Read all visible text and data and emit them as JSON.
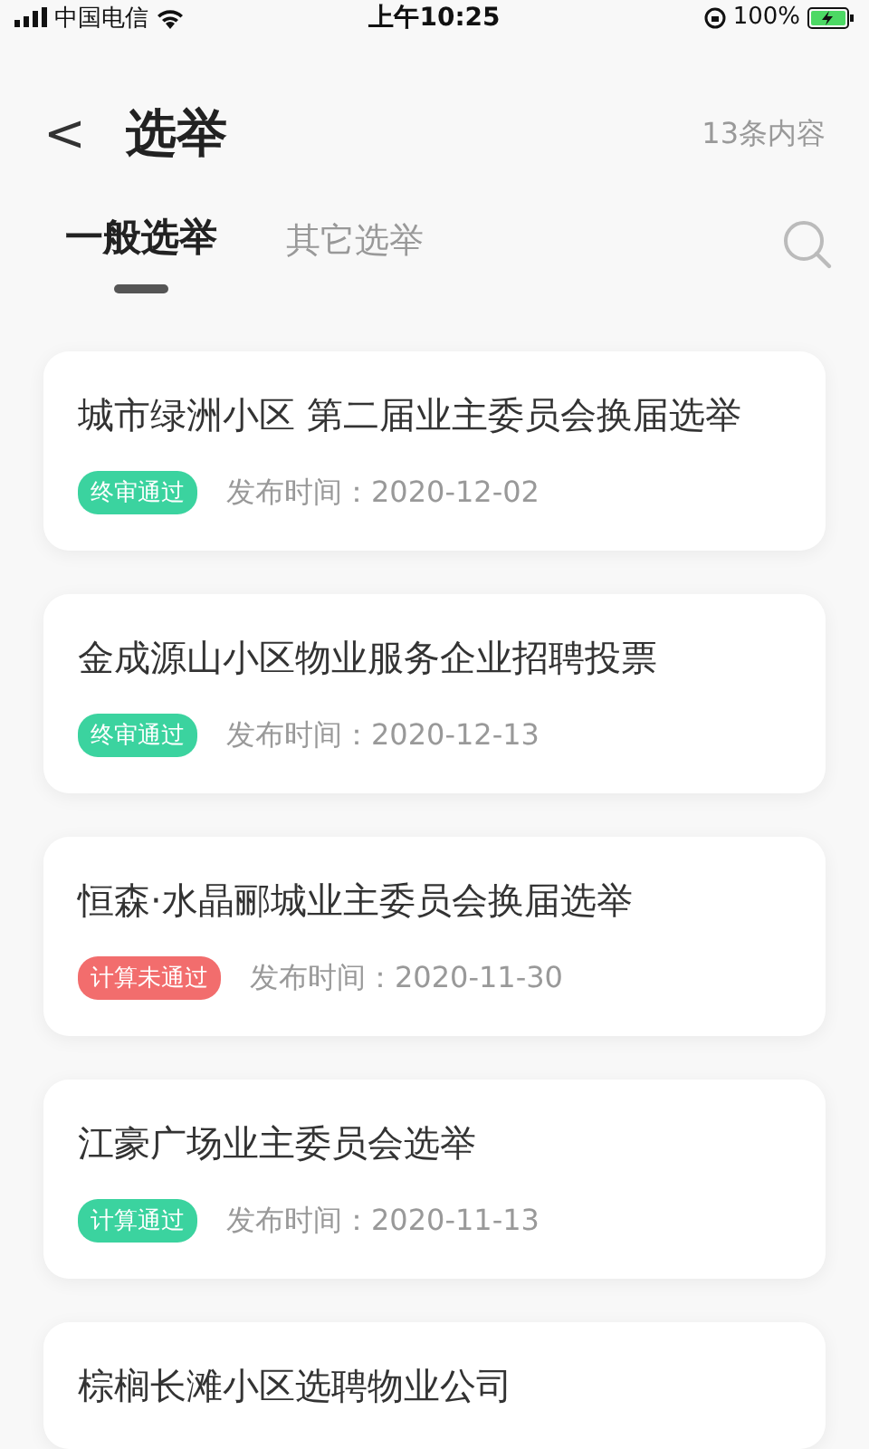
{
  "status_bar": {
    "carrier": "中国电信",
    "time": "上午10:25",
    "battery": "100%"
  },
  "header": {
    "back": "<",
    "title": "选举",
    "count": "13条内容"
  },
  "tabs": [
    {
      "label": "一般选举",
      "selected": true
    },
    {
      "label": "其它选举",
      "selected": false
    }
  ],
  "items": [
    {
      "title": "城市绿洲小区 第二届业主委员会换届选举",
      "tag": "终审通过",
      "color": "#3bd39f",
      "date_label": "发布时间：",
      "date": "2020-12-02"
    },
    {
      "title": "金成源山小区物业服务企业招聘投票",
      "tag": "终审通过",
      "color": "#3bd39f",
      "date_label": "发布时间：",
      "date": "2020-12-13"
    },
    {
      "title": "恒森·水晶郦城业主委员会换届选举",
      "tag": "计算未通过",
      "color": "#f26d6d",
      "date_label": "发布时间：",
      "date": "2020-11-30"
    },
    {
      "title": "江豪广场业主委员会选举",
      "tag": "计算通过",
      "color": "#3bd39f",
      "date_label": "发布时间：",
      "date": "2020-11-13"
    },
    {
      "title": "棕榈长滩小区选聘物业公司"
    }
  ]
}
